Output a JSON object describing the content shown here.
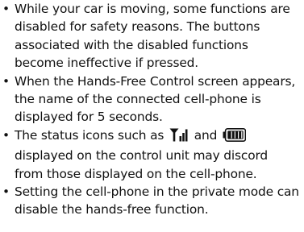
{
  "bullet_char": "•",
  "notes": [
    {
      "text": "While your car is moving, some functions are disabled for safety reasons. The buttons associated with the disabled functions become ineffective if pressed."
    },
    {
      "text": "When the Hands-Free Control screen appears, the name of the connected cell-phone is displayed for 5 seconds."
    },
    {
      "before": "The status icons such as",
      "between": "and",
      "after": "displayed on the control unit may discord from those displayed on the cell-phone."
    },
    {
      "text": "Setting the cell-phone in the private mode can disable the hands-free function."
    }
  ],
  "icons": {
    "first": "signal-strength-icon",
    "second": "battery-level-icon"
  }
}
